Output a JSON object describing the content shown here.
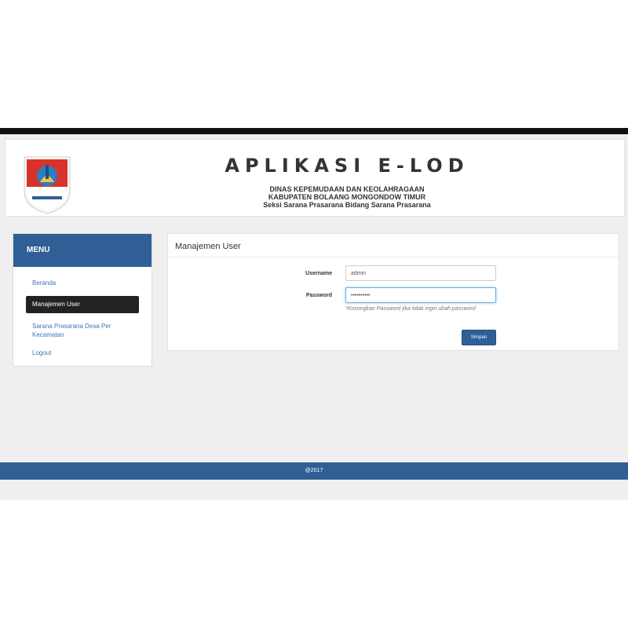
{
  "header": {
    "title": "APLIKASI E-LOD",
    "org_line1": "DINAS KEPEMUDAAN DAN KEOLAHRAGAAN",
    "org_line2": "KABUPATEN BOLAANG MONGONDOW TIMUR",
    "org_line3": "Seksi Sarana Prasarana Bidang Sarana Prasarana"
  },
  "sidebar": {
    "heading": "MENU",
    "items": [
      {
        "label": "Beranda"
      },
      {
        "label": "Manajemen User"
      },
      {
        "label": "Sarana Prasarana Desa Per Kecamatan"
      },
      {
        "label": "Logout"
      }
    ]
  },
  "content": {
    "title": "Manajemen User",
    "username_label": "Username",
    "username_value": "admin",
    "password_label": "Password",
    "password_value": "••••••••••",
    "password_help": "*Kosongkan Password jika tidak ingin ubah password",
    "save_label": "Simpan"
  },
  "footer": {
    "text": "@2017"
  },
  "colors": {
    "primary": "#2f5f95",
    "active_menu": "#222222",
    "link": "#3d78b3",
    "background": "#efefef"
  }
}
